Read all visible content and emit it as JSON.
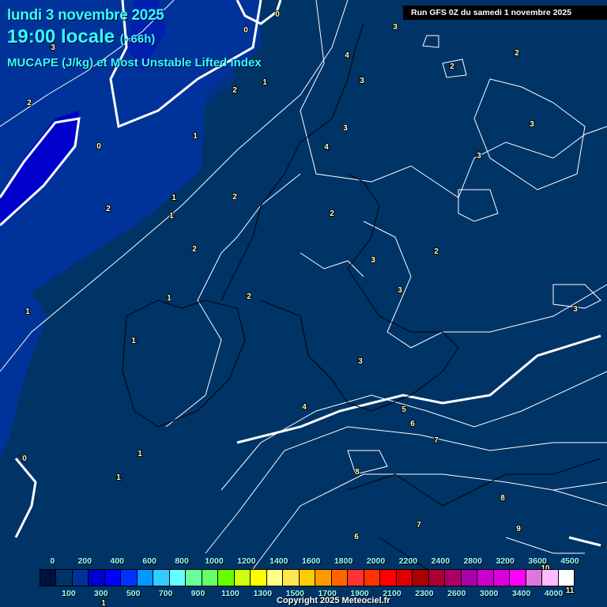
{
  "header": {
    "date": "lundi 3 novembre 2025",
    "time": "19:00 locale",
    "lead": "(+66h)",
    "parameter": "MUCAPE (J/kg) et Most Unstable Lifted Index",
    "run": "Run GFS 0Z du samedi 1 novembre 2025"
  },
  "legend": {
    "values": [
      "0",
      "100",
      "200",
      "300",
      "400",
      "500",
      "600",
      "700",
      "800",
      "900",
      "1000",
      "1100",
      "1200",
      "1300",
      "1400",
      "1500",
      "1600",
      "1700",
      "1800",
      "1900",
      "2000",
      "2100",
      "2200",
      "2300",
      "2400",
      "2600",
      "2800",
      "3000",
      "3200",
      "3400",
      "3600",
      "4000",
      "4500"
    ],
    "colors": [
      "#001040",
      "#003366",
      "#003399",
      "#0000cc",
      "#0000ff",
      "#0033ff",
      "#0099ff",
      "#33ccff",
      "#66ffff",
      "#66ff99",
      "#66ff66",
      "#66ff00",
      "#ccff11",
      "#ffff00",
      "#ffff88",
      "#ffe650",
      "#ffcc00",
      "#ff9900",
      "#ff6600",
      "#ff3333",
      "#ff3300",
      "#ff0000",
      "#dd0000",
      "#aa0000",
      "#aa0033",
      "#aa0066",
      "#aa00aa",
      "#cc00cc",
      "#dd00dd",
      "#ff00ff",
      "#dd77dd",
      "#ffbbff",
      "#ffffff"
    ]
  },
  "contour_labels": [
    "0",
    "0",
    "0",
    "3",
    "2",
    "1",
    "2",
    "1",
    "1",
    "1",
    "2",
    "2",
    "1",
    "2",
    "1",
    "1",
    "1",
    "1",
    "4",
    "3",
    "3",
    "4",
    "3",
    "2",
    "3",
    "2",
    "3",
    "2",
    "3",
    "2",
    "3",
    "3",
    "3",
    "4",
    "5",
    "6",
    "7",
    "8",
    "8",
    "7",
    "6",
    "9",
    "10",
    "11",
    "2",
    "0",
    "1"
  ],
  "colors": {
    "background": "#003366",
    "title": "#33ffff",
    "low_cape": "#003399",
    "mid_cape": "#0000cc"
  },
  "copyright": "Copyright 2025 Meteociel.fr"
}
